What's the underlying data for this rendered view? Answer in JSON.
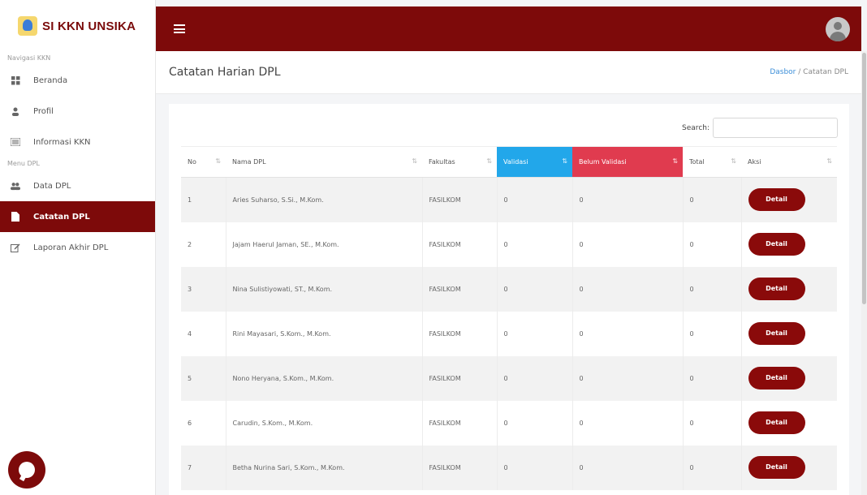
{
  "brand": {
    "name": "SI KKN UNSIKA"
  },
  "sidebar": {
    "section1": "Navigasi KKN",
    "items1": [
      {
        "label": "Beranda",
        "icon": "grid-icon"
      },
      {
        "label": "Profil",
        "icon": "user-icon"
      },
      {
        "label": "Informasi KKN",
        "icon": "list-icon"
      }
    ],
    "section2": "Menu DPL",
    "items2": [
      {
        "label": "Data DPL",
        "icon": "users-icon"
      },
      {
        "label": "Catatan DPL",
        "icon": "file-icon",
        "active": true
      },
      {
        "label": "Laporan Akhir DPL",
        "icon": "edit-icon"
      }
    ]
  },
  "header": {
    "title": "Catatan Harian DPL",
    "breadcrumb_home": "Dasbor",
    "breadcrumb_sep": "/",
    "breadcrumb_current": "Catatan DPL"
  },
  "search": {
    "label": "Search:",
    "value": ""
  },
  "table": {
    "columns": [
      "No",
      "Nama DPL",
      "Fakultas",
      "Validasi",
      "Belum Validasi",
      "Total",
      "Aksi"
    ],
    "rows": [
      {
        "no": "1",
        "nama": "Aries Suharso, S.Si., M.Kom.",
        "fakultas": "FASILKOM",
        "validasi": "0",
        "belum": "0",
        "total": "0",
        "aksi": "Detail"
      },
      {
        "no": "2",
        "nama": "Jajam Haerul Jaman, SE., M.Kom.",
        "fakultas": "FASILKOM",
        "validasi": "0",
        "belum": "0",
        "total": "0",
        "aksi": "Detail"
      },
      {
        "no": "3",
        "nama": "Nina Sulistiyowati, ST., M.Kom.",
        "fakultas": "FASILKOM",
        "validasi": "0",
        "belum": "0",
        "total": "0",
        "aksi": "Detail"
      },
      {
        "no": "4",
        "nama": "Rini Mayasari, S.Kom., M.Kom.",
        "fakultas": "FASILKOM",
        "validasi": "0",
        "belum": "0",
        "total": "0",
        "aksi": "Detail"
      },
      {
        "no": "5",
        "nama": "Nono Heryana, S.Kom., M.Kom.",
        "fakultas": "FASILKOM",
        "validasi": "0",
        "belum": "0",
        "total": "0",
        "aksi": "Detail"
      },
      {
        "no": "6",
        "nama": "Carudin, S.Kom., M.Kom.",
        "fakultas": "FASILKOM",
        "validasi": "0",
        "belum": "0",
        "total": "0",
        "aksi": "Detail"
      },
      {
        "no": "7",
        "nama": "Betha Nurina Sari, S.Kom., M.Kom.",
        "fakultas": "FASILKOM",
        "validasi": "0",
        "belum": "0",
        "total": "0",
        "aksi": "Detail"
      }
    ]
  },
  "colors": {
    "primary": "#7d0a0a",
    "validasi_header": "#22a7ea",
    "belum_header": "#e03b4f"
  }
}
